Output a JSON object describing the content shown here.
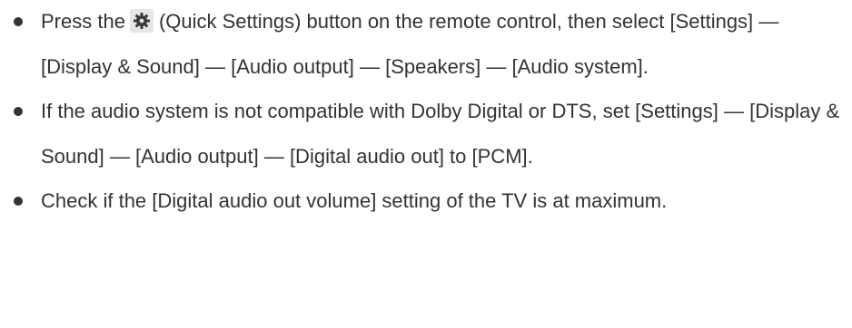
{
  "items": [
    {
      "before_icon": "Press the",
      "icon": "gear-icon",
      "after_icon": "(Quick Settings) button on the remote control, then select [Settings] — [Display & Sound] — [Audio output] — [Speakers] — [Audio system]."
    },
    {
      "text": "If the audio system is not compatible with Dolby Digital or DTS, set [Settings] — [Display & Sound] — [Audio output] — [Digital audio out] to [PCM]."
    },
    {
      "text": "Check if the [Digital audio out volume] setting of the TV is at maximum."
    }
  ],
  "colors": {
    "text": "#333333",
    "icon_bg": "#e6e6e6",
    "icon_fg": "#3a3a3a"
  }
}
